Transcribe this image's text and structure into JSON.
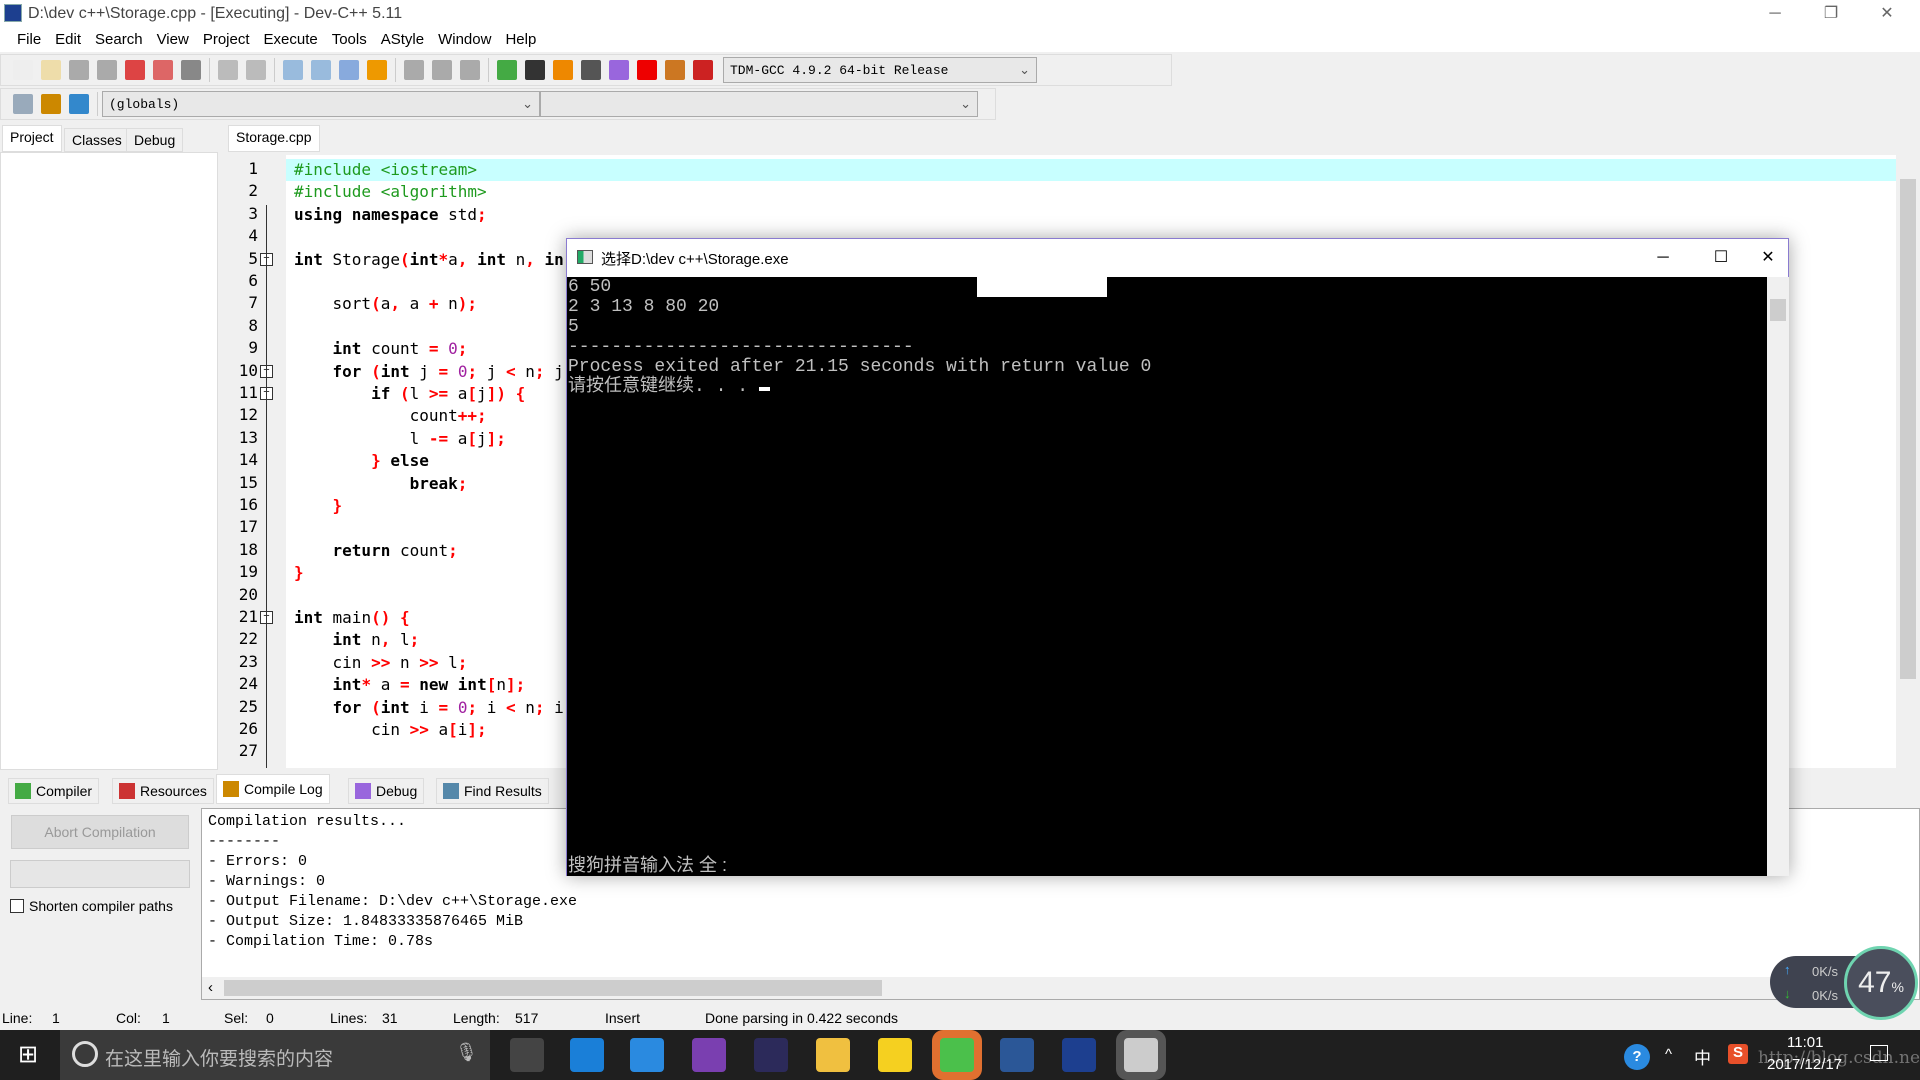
{
  "window": {
    "title": "D:\\dev c++\\Storage.cpp - [Executing] - Dev-C++ 5.11"
  },
  "menu": [
    "File",
    "Edit",
    "Search",
    "View",
    "Project",
    "Execute",
    "Tools",
    "AStyle",
    "Window",
    "Help"
  ],
  "toolbar": {
    "compiler": "TDM-GCC 4.9.2 64-bit Release",
    "scope": "(globals)",
    "member": ""
  },
  "left_tabs": [
    "Project",
    "Classes",
    "Debug"
  ],
  "editor": {
    "tab": "Storage.cpp",
    "current_line": 1,
    "lines": [
      [
        [
          "#include <iostream>",
          "p"
        ]
      ],
      [
        [
          "#include <algorithm>",
          "p"
        ]
      ],
      [
        [
          "using namespace",
          "k"
        ],
        [
          " std",
          "i"
        ],
        [
          ";",
          "s"
        ]
      ],
      [],
      [
        [
          "int",
          "k"
        ],
        [
          " Storage",
          "i"
        ],
        [
          "(",
          "s"
        ],
        [
          "int",
          "k"
        ],
        [
          "*",
          "s"
        ],
        [
          "a",
          "i"
        ],
        [
          ",",
          "s"
        ],
        [
          " ",
          "i"
        ],
        [
          "int",
          "k"
        ],
        [
          " n",
          "i"
        ],
        [
          ",",
          "s"
        ],
        [
          " in",
          "k"
        ]
      ],
      [],
      [
        [
          "    sort",
          "i"
        ],
        [
          "(",
          "s"
        ],
        [
          "a",
          "i"
        ],
        [
          ",",
          "s"
        ],
        [
          " a ",
          "i"
        ],
        [
          "+",
          "s"
        ],
        [
          " n",
          "i"
        ],
        [
          ");",
          "s"
        ]
      ],
      [],
      [
        [
          "    ",
          "i"
        ],
        [
          "int",
          "k"
        ],
        [
          " count ",
          "i"
        ],
        [
          "=",
          "s"
        ],
        [
          " ",
          "i"
        ],
        [
          "0",
          "n"
        ],
        [
          ";",
          "s"
        ]
      ],
      [
        [
          "    ",
          "i"
        ],
        [
          "for",
          "k"
        ],
        [
          " ",
          "i"
        ],
        [
          "(",
          "s"
        ],
        [
          "int",
          "k"
        ],
        [
          " j ",
          "i"
        ],
        [
          "=",
          "s"
        ],
        [
          " ",
          "i"
        ],
        [
          "0",
          "n"
        ],
        [
          ";",
          "s"
        ],
        [
          " j ",
          "i"
        ],
        [
          "<",
          "s"
        ],
        [
          " n",
          "i"
        ],
        [
          ";",
          "s"
        ],
        [
          " j",
          "i"
        ]
      ],
      [
        [
          "        ",
          "i"
        ],
        [
          "if",
          "k"
        ],
        [
          " ",
          "i"
        ],
        [
          "(",
          "s"
        ],
        [
          "l ",
          "i"
        ],
        [
          ">=",
          "s"
        ],
        [
          " a",
          "i"
        ],
        [
          "[",
          "s"
        ],
        [
          "j",
          "i"
        ],
        [
          "])",
          "s"
        ],
        [
          " ",
          "i"
        ],
        [
          "{",
          "s"
        ]
      ],
      [
        [
          "            count",
          "i"
        ],
        [
          "++;",
          "s"
        ]
      ],
      [
        [
          "            l ",
          "i"
        ],
        [
          "-=",
          "s"
        ],
        [
          " a",
          "i"
        ],
        [
          "[",
          "s"
        ],
        [
          "j",
          "i"
        ],
        [
          "];",
          "s"
        ]
      ],
      [
        [
          "        ",
          "i"
        ],
        [
          "}",
          "s"
        ],
        [
          " ",
          "i"
        ],
        [
          "else",
          "k"
        ]
      ],
      [
        [
          "            ",
          "i"
        ],
        [
          "break",
          "k"
        ],
        [
          ";",
          "s"
        ]
      ],
      [
        [
          "    ",
          "i"
        ],
        [
          "}",
          "s"
        ]
      ],
      [],
      [
        [
          "    ",
          "i"
        ],
        [
          "return",
          "k"
        ],
        [
          " count",
          "i"
        ],
        [
          ";",
          "s"
        ]
      ],
      [
        [
          "}",
          "s"
        ]
      ],
      [],
      [
        [
          "int",
          "k"
        ],
        [
          " main",
          "i"
        ],
        [
          "()",
          "s"
        ],
        [
          " ",
          "i"
        ],
        [
          "{",
          "s"
        ]
      ],
      [
        [
          "    ",
          "i"
        ],
        [
          "int",
          "k"
        ],
        [
          " n",
          "i"
        ],
        [
          ",",
          "s"
        ],
        [
          " l",
          "i"
        ],
        [
          ";",
          "s"
        ]
      ],
      [
        [
          "    cin ",
          "i"
        ],
        [
          ">>",
          "s"
        ],
        [
          " n ",
          "i"
        ],
        [
          ">>",
          "s"
        ],
        [
          " l",
          "i"
        ],
        [
          ";",
          "s"
        ]
      ],
      [
        [
          "    ",
          "i"
        ],
        [
          "int",
          "k"
        ],
        [
          "*",
          "s"
        ],
        [
          " a ",
          "i"
        ],
        [
          "=",
          "s"
        ],
        [
          " ",
          "i"
        ],
        [
          "new int",
          "k"
        ],
        [
          "[",
          "s"
        ],
        [
          "n",
          "i"
        ],
        [
          "];",
          "s"
        ]
      ],
      [
        [
          "    ",
          "i"
        ],
        [
          "for",
          "k"
        ],
        [
          " ",
          "i"
        ],
        [
          "(",
          "s"
        ],
        [
          "int",
          "k"
        ],
        [
          " i ",
          "i"
        ],
        [
          "=",
          "s"
        ],
        [
          " ",
          "i"
        ],
        [
          "0",
          "n"
        ],
        [
          ";",
          "s"
        ],
        [
          " i ",
          "i"
        ],
        [
          "<",
          "s"
        ],
        [
          " n",
          "i"
        ],
        [
          ";",
          "s"
        ],
        [
          " i",
          "i"
        ]
      ],
      [
        [
          "        cin ",
          "i"
        ],
        [
          ">>",
          "s"
        ],
        [
          " a",
          "i"
        ],
        [
          "[",
          "s"
        ],
        [
          "i",
          "i"
        ],
        [
          "];",
          "s"
        ]
      ],
      []
    ]
  },
  "console": {
    "title": "选择D:\\dev c++\\Storage.exe",
    "output": "6 50\n2 3 13 8 80 20\n5\n--------------------------------\nProcess exited after 21.15 seconds with return value 0\n请按任意键继续. . . ",
    "ime": "搜狗拼音输入法 全 :"
  },
  "bottom_tabs": [
    "Compiler",
    "Resources",
    "Compile Log",
    "Debug",
    "Find Results"
  ],
  "compile": {
    "abort_label": "Abort Compilation",
    "shorten_label": "Shorten compiler paths",
    "shorten_checked": false,
    "log": "Compilation results...\n--------\n- Errors: 0\n- Warnings: 0\n- Output Filename: D:\\dev c++\\Storage.exe\n- Output Size: 1.84833335876465 MiB\n- Compilation Time: 0.78s"
  },
  "status": {
    "line": "Line:",
    "line_v": "1",
    "col": "Col:",
    "col_v": "1",
    "sel": "Sel:",
    "sel_v": "0",
    "lines": "Lines:",
    "lines_v": "31",
    "length": "Length:",
    "length_v": "517",
    "mode": "Insert",
    "message": "Done parsing in 0.422 seconds"
  },
  "net": {
    "up": "0K/s",
    "down": "0K/s",
    "percent": "47",
    "unit": "%"
  },
  "taskbar": {
    "search_placeholder": "在这里输入你要搜索的内容",
    "ime": "中",
    "time": "11:01",
    "date": "2017/12/17",
    "watermark": "http://blog.csdn.net/fyinh_"
  }
}
